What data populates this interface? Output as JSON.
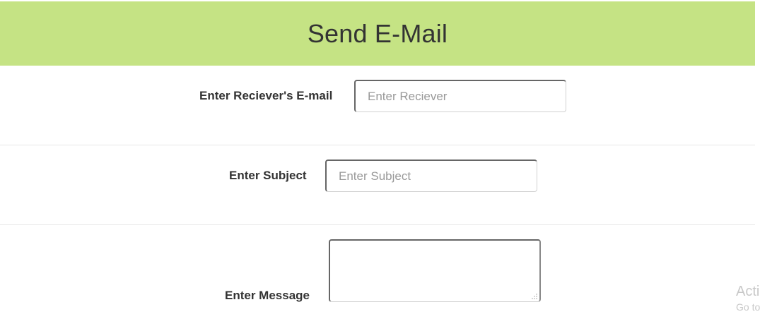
{
  "header": {
    "title": "Send E-Mail",
    "background": "#c5e384"
  },
  "form": {
    "receiver": {
      "label": "Enter Reciever's E-mail",
      "placeholder": "Enter Reciever",
      "value": ""
    },
    "subject": {
      "label": "Enter Subject",
      "placeholder": "Enter Subject",
      "value": ""
    },
    "message": {
      "label": "Enter Message",
      "value": ""
    }
  },
  "watermark": {
    "line1": "Acti",
    "line2": "Go to"
  }
}
